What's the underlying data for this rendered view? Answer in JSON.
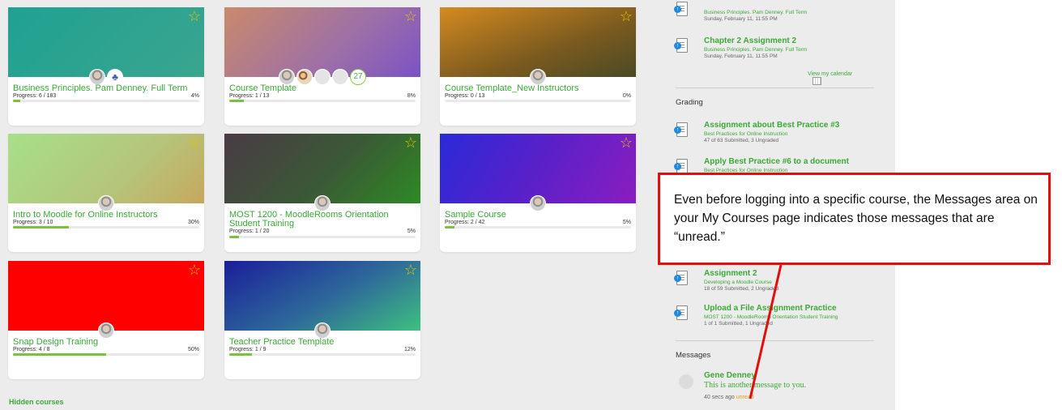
{
  "courses": [
    {
      "title": "Business Principles. Pam Denney. Full Term",
      "progress": "Progress: 6 / 183",
      "percent": "4%",
      "fill": 0.04
    },
    {
      "title": "Course Template",
      "progress": "Progress: 1 / 13",
      "percent": "8%",
      "fill": 0.08,
      "participant_count": "27"
    },
    {
      "title": "Course Template_New Instructors",
      "progress": "Progress: 0 / 13",
      "percent": "0%",
      "fill": 0.0
    },
    {
      "title": "Intro to Moodle for Online Instructors",
      "progress": "Progress: 3 / 10",
      "percent": "30%",
      "fill": 0.3
    },
    {
      "title": "MOST 1200 - MoodleRooms Orientation Student Training",
      "progress": "Progress: 1 / 20",
      "percent": "5%",
      "fill": 0.05
    },
    {
      "title": "Sample Course",
      "progress": "Progress: 2 / 42",
      "percent": "5%",
      "fill": 0.05
    },
    {
      "title": "Snap Design Training",
      "progress": "Progress: 4 / 8",
      "percent": "50%",
      "fill": 0.5
    },
    {
      "title": "Teacher Practice Template",
      "progress": "Progress: 1 / 9",
      "percent": "12%",
      "fill": 0.12
    }
  ],
  "hidden_courses_label": "Hidden courses",
  "deadlines": [
    {
      "course": "Business Principles. Pam Denney. Full Term",
      "date": "Sunday, February 11, 11:55 PM"
    },
    {
      "title": "Chapter 2 Assignment 2",
      "course": "Business Principles. Pam Denney. Full Term",
      "date": "Sunday, February 11, 11:55 PM"
    }
  ],
  "view_calendar": "View my calendar",
  "grading_heading": "Grading",
  "grading": [
    {
      "title": "Assignment about Best Practice #3",
      "course": "Best Practices for Online Instruction",
      "status": "47 of 63 Submitted, 3 Ungraded"
    },
    {
      "title": "Apply Best Practice #6 to a document",
      "course": "Best Practices for Online Instruction"
    },
    {
      "title": "Assignment 2",
      "course": "Developing a Moodle Course",
      "status": "18 of 59 Submitted, 2 Ungraded"
    },
    {
      "title": "Upload a File Assignment Practice",
      "course": "MOST 1200 - MoodleRooms Orientation Student Training",
      "status": "1 of 1 Submitted, 1 Ungraded"
    }
  ],
  "messages_heading": "Messages",
  "message": {
    "sender": "Gene Denney",
    "text": "This is another message to you.",
    "time": "40 secs ago",
    "status": "unread"
  },
  "callout_text": "Even before logging into a specific course, the Messages area on your My Courses page indicates those messages that are “unread.”",
  "colors": {
    "link": "#3aaa35",
    "progress": "#7cc043",
    "star": "#e6c200",
    "callout_border": "#e0100f",
    "unread": "#f39c12"
  }
}
